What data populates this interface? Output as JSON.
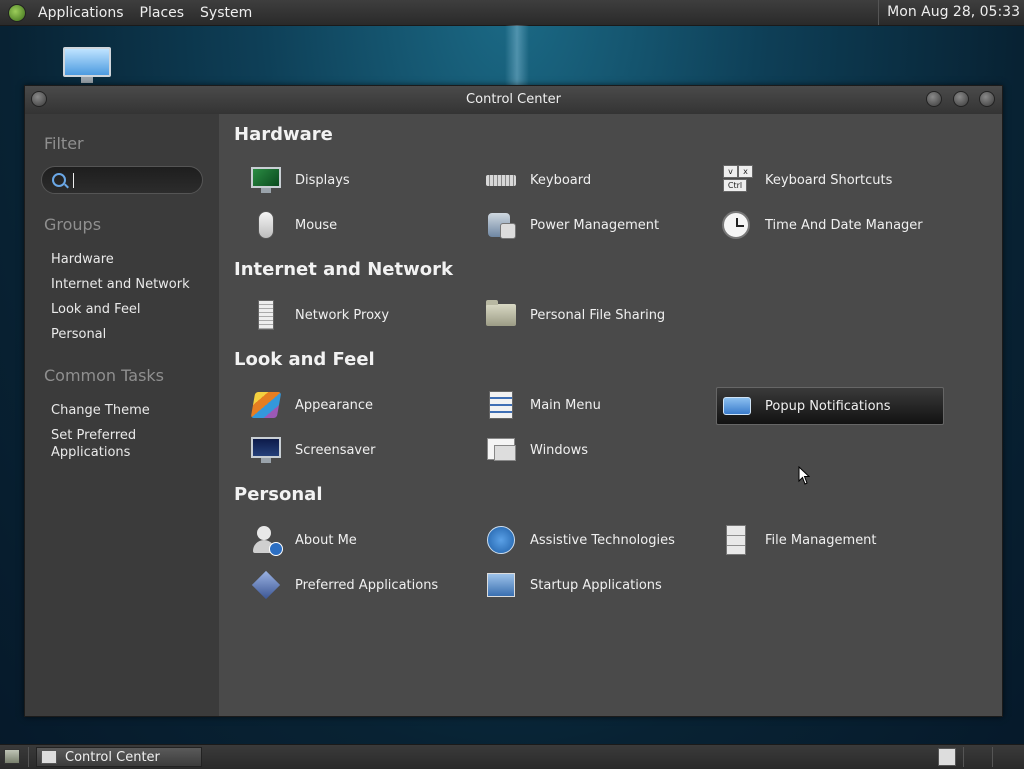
{
  "top_panel": {
    "menus": [
      "Applications",
      "Places",
      "System"
    ],
    "clock": "Mon Aug 28, 05:33"
  },
  "window": {
    "title": "Control Center",
    "sidebar": {
      "filter_heading": "Filter",
      "search_value": "",
      "groups_heading": "Groups",
      "groups": [
        "Hardware",
        "Internet and Network",
        "Look and Feel",
        "Personal"
      ],
      "tasks_heading": "Common Tasks",
      "tasks": [
        "Change Theme",
        "Set Preferred Applications"
      ]
    },
    "sections": [
      {
        "title": "Hardware",
        "items": [
          "Displays",
          "Keyboard",
          "Keyboard Shortcuts",
          "Mouse",
          "Power Management",
          "Time And Date Manager"
        ]
      },
      {
        "title": "Internet and Network",
        "items": [
          "Network Proxy",
          "Personal File Sharing"
        ]
      },
      {
        "title": "Look and Feel",
        "items": [
          "Appearance",
          "Main Menu",
          "Popup Notifications",
          "Screensaver",
          "Windows"
        ]
      },
      {
        "title": "Personal",
        "items": [
          "About Me",
          "Assistive Technologies",
          "File Management",
          "Preferred Applications",
          "Startup Applications"
        ]
      }
    ],
    "selected_item": "Popup Notifications"
  },
  "taskbar": {
    "task_label": "Control Center"
  },
  "keyboard_shortcut_keys": [
    "v",
    "x",
    "Ctrl"
  ]
}
